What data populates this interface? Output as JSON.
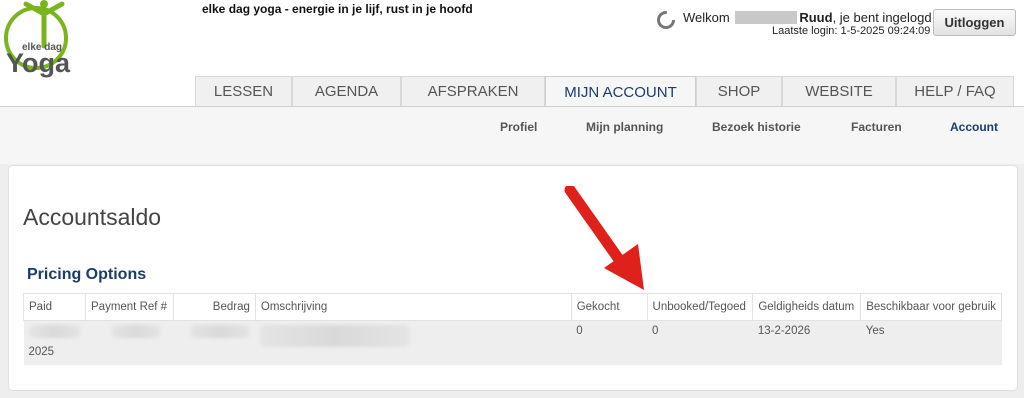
{
  "header": {
    "tagline": "elke dag yoga - energie in je lijf, rust in je hoofd",
    "logo": {
      "line1": "elke dag",
      "line2": "Yoga",
      "icon": "yoga-person-icon"
    },
    "welcome_prefix": "Welkom",
    "user_name": "Ruud",
    "welcome_suffix": ", je bent ingelogd",
    "last_login": "Laatste login: 1-5-2025 09:24:09",
    "logout_label": "Uitloggen"
  },
  "tabs": [
    "LESSEN",
    "AGENDA",
    "AFSPRAKEN",
    "MIJN ACCOUNT",
    "SHOP",
    "WEBSITE",
    "HELP / FAQ"
  ],
  "active_tab": "MIJN ACCOUNT",
  "subnav": [
    "Profiel",
    "Mijn planning",
    "Bezoek historie",
    "Facturen",
    "Account"
  ],
  "active_subnav": "Account",
  "main": {
    "title": "Accountsaldo",
    "section_title": "Pricing Options",
    "columns": [
      "Paid",
      "Payment Ref #",
      "Bedrag",
      "Omschrijving",
      "Gekocht",
      "Unbooked/Tegoed",
      "Geldigheids datum",
      "Beschikbaar voor gebruik"
    ],
    "row": {
      "paid_year": "2025",
      "gekocht": "0",
      "unbooked": "0",
      "geldigheid": "13-2-2026",
      "beschikbaar": "Yes"
    }
  },
  "colors": {
    "brand_green": "#7ab51d",
    "logo_grey": "#555555",
    "nav_blue": "#1b3d6b",
    "arrow_red": "#e0201b"
  }
}
